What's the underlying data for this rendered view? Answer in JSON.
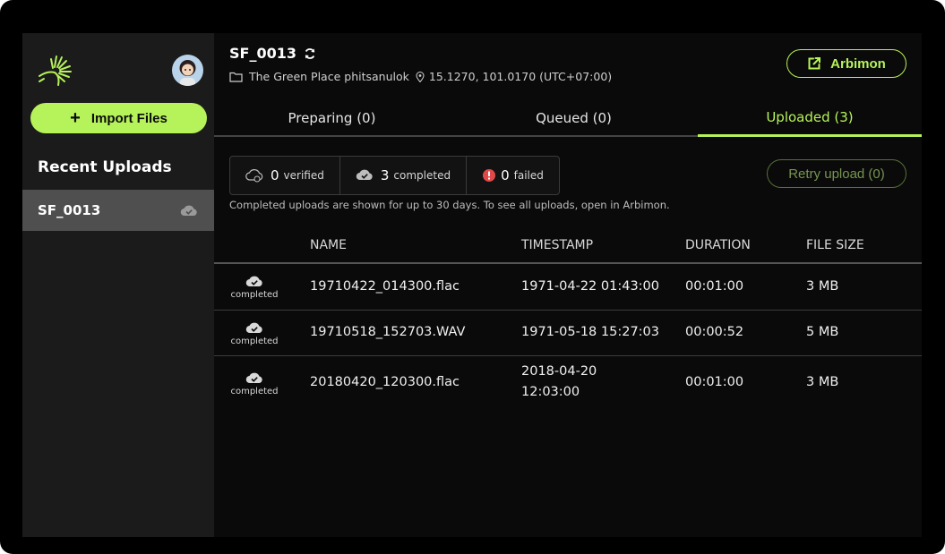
{
  "sidebar": {
    "import_label": "Import Files",
    "recent_title": "Recent Uploads",
    "recent_items": [
      {
        "label": "SF_0013",
        "icon": "cloud-check-icon"
      }
    ]
  },
  "header": {
    "site_name": "SF_0013",
    "site_location": "The Green Place phitsanulok",
    "coordinates": "15.1270, 101.0170 (UTC+07:00)",
    "arbimon_label": "Arbimon"
  },
  "tabs": [
    {
      "label": "Preparing (0)",
      "active": false
    },
    {
      "label": "Queued (0)",
      "active": false
    },
    {
      "label": "Uploaded (3)",
      "active": true
    }
  ],
  "stats": {
    "verified_count": "0",
    "verified_label": "verified",
    "completed_count": "3",
    "completed_label": "completed",
    "failed_count": "0",
    "failed_label": "failed"
  },
  "retry_label": "Retry upload (0)",
  "note": "Completed uploads are shown for up to 30 days. To see all uploads, open in Arbimon.",
  "table": {
    "columns": [
      "NAME",
      "TIMESTAMP",
      "DURATION",
      "FILE SIZE"
    ],
    "rows": [
      {
        "status": "completed",
        "name": "19710422_014300.flac",
        "timestamp": "1971-04-22 01:43:00",
        "duration": "00:01:00",
        "size": "3 MB"
      },
      {
        "status": "completed",
        "name": "19710518_152703.WAV",
        "timestamp": "1971-05-18 15:27:03",
        "duration": "00:00:52",
        "size": "5 MB"
      },
      {
        "status": "completed",
        "name": "20180420_120300.flac",
        "timestamp_line1": "2018-04-20",
        "timestamp_line2": "12:03:00",
        "duration": "00:01:00",
        "size": "3 MB"
      }
    ]
  },
  "colors": {
    "accent": "#b6f25a",
    "background": "#0a0a0a",
    "sidebar": "#1b1b1b",
    "selected": "#4f4f4f",
    "failed": "#e0494a"
  }
}
